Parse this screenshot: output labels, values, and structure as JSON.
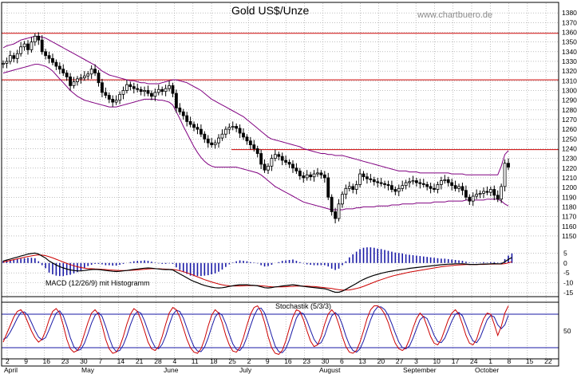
{
  "chart_data": {
    "type": "candlestick",
    "title": "Gold US$/Unze",
    "watermark": "www.chartbuero.de",
    "colors": {
      "candle": "#000000",
      "bollinger": "#800080",
      "resistance": "#cc0000",
      "grid": "#999999",
      "macd_line": "#000000",
      "signal_line": "#cc0000",
      "histogram": "#1a1aa6",
      "stoch_k": "#cc0000",
      "stoch_d": "#1a1aa6",
      "stoch_level": "#1a1aa6"
    },
    "price_panel": {
      "ylim": [
        1145,
        1390
      ],
      "y_ticks": [
        1150,
        1160,
        1170,
        1180,
        1190,
        1200,
        1210,
        1220,
        1230,
        1240,
        1250,
        1260,
        1270,
        1280,
        1290,
        1300,
        1310,
        1320,
        1330,
        1340,
        1350,
        1360,
        1370,
        1380
      ],
      "resistance_lines": [
        1359,
        1311,
        1239
      ],
      "close": [
        1328,
        1330,
        1336,
        1333,
        1338,
        1345,
        1348,
        1342,
        1350,
        1356,
        1352,
        1340,
        1336,
        1333,
        1329,
        1325,
        1322,
        1318,
        1314,
        1305,
        1309,
        1312,
        1313,
        1315,
        1317,
        1322,
        1318,
        1308,
        1298,
        1295,
        1291,
        1288,
        1290,
        1296,
        1300,
        1306,
        1304,
        1302,
        1301,
        1299,
        1300,
        1297,
        1294,
        1298,
        1301,
        1299,
        1302,
        1305,
        1297,
        1282,
        1278,
        1274,
        1268,
        1265,
        1262,
        1260,
        1255,
        1250,
        1246,
        1244,
        1246,
        1251,
        1255,
        1260,
        1262,
        1263,
        1261,
        1256,
        1252,
        1248,
        1244,
        1240,
        1235,
        1224,
        1218,
        1222,
        1230,
        1234,
        1232,
        1228,
        1226,
        1224,
        1220,
        1217,
        1212,
        1210,
        1213,
        1211,
        1214,
        1215,
        1213,
        1210,
        1190,
        1175,
        1168,
        1183,
        1193,
        1199,
        1201,
        1198,
        1203,
        1214,
        1211,
        1209,
        1208,
        1206,
        1205,
        1204,
        1203,
        1202,
        1198,
        1196,
        1199,
        1202,
        1205,
        1206,
        1207,
        1205,
        1204,
        1203,
        1201,
        1199,
        1198,
        1203,
        1207,
        1208,
        1205,
        1202,
        1199,
        1201,
        1197,
        1190,
        1186,
        1191,
        1193,
        1194,
        1196,
        1195,
        1198,
        1192,
        1188,
        1201,
        1225,
        1221
      ],
      "upper_band": [
        1344,
        1346,
        1347,
        1348,
        1350,
        1352,
        1353,
        1354,
        1355,
        1356,
        1356,
        1355,
        1354,
        1352,
        1350,
        1348,
        1346,
        1344,
        1342,
        1340,
        1338,
        1336,
        1334,
        1332,
        1330,
        1328,
        1326,
        1323,
        1320,
        1318,
        1316,
        1315,
        1314,
        1313,
        1312,
        1311,
        1310,
        1310,
        1309,
        1308,
        1308,
        1307,
        1307,
        1307,
        1307,
        1308,
        1309,
        1310,
        1311,
        1311,
        1310,
        1309,
        1308,
        1306,
        1304,
        1302,
        1300,
        1297,
        1294,
        1291,
        1289,
        1287,
        1285,
        1283,
        1281,
        1279,
        1277,
        1275,
        1273,
        1270,
        1267,
        1264,
        1261,
        1258,
        1255,
        1252,
        1250,
        1249,
        1248,
        1247,
        1246,
        1245,
        1244,
        1243,
        1242,
        1240,
        1239,
        1238,
        1237,
        1236,
        1235,
        1235,
        1234,
        1234,
        1233,
        1233,
        1233,
        1232,
        1231,
        1230,
        1229,
        1228,
        1227,
        1226,
        1225,
        1224,
        1223,
        1222,
        1221,
        1220,
        1219,
        1218,
        1217,
        1217,
        1217,
        1216,
        1216,
        1216,
        1215,
        1215,
        1215,
        1215,
        1215,
        1215,
        1215,
        1215,
        1215,
        1214,
        1214,
        1214,
        1214,
        1213,
        1213,
        1213,
        1213,
        1213,
        1213,
        1213,
        1213,
        1213,
        1213,
        1222,
        1234,
        1238
      ],
      "lower_band": [
        1318,
        1319,
        1320,
        1321,
        1322,
        1323,
        1324,
        1325,
        1326,
        1327,
        1327,
        1326,
        1325,
        1323,
        1320,
        1316,
        1312,
        1308,
        1304,
        1300,
        1297,
        1294,
        1292,
        1290,
        1289,
        1288,
        1287,
        1286,
        1285,
        1284,
        1283,
        1283,
        1283,
        1284,
        1285,
        1286,
        1287,
        1288,
        1289,
        1290,
        1291,
        1291,
        1291,
        1291,
        1290,
        1290,
        1289,
        1288,
        1285,
        1278,
        1271,
        1263,
        1256,
        1249,
        1242,
        1236,
        1231,
        1227,
        1224,
        1222,
        1221,
        1221,
        1221,
        1221,
        1221,
        1221,
        1221,
        1220,
        1219,
        1218,
        1217,
        1216,
        1215,
        1213,
        1210,
        1207,
        1204,
        1201,
        1199,
        1197,
        1195,
        1193,
        1191,
        1189,
        1187,
        1185,
        1184,
        1183,
        1182,
        1181,
        1180,
        1179,
        1178,
        1177,
        1177,
        1177,
        1177,
        1178,
        1178,
        1178,
        1179,
        1179,
        1180,
        1180,
        1180,
        1180,
        1181,
        1181,
        1181,
        1181,
        1182,
        1182,
        1182,
        1183,
        1183,
        1183,
        1183,
        1184,
        1184,
        1184,
        1184,
        1184,
        1185,
        1185,
        1185,
        1185,
        1186,
        1186,
        1186,
        1186,
        1186,
        1187,
        1187,
        1187,
        1187,
        1187,
        1187,
        1188,
        1188,
        1188,
        1188,
        1186,
        1183,
        1181
      ]
    },
    "macd_panel": {
      "label": "MACD (12/26/9) mit Histogramm",
      "ylim": [
        -17,
        10
      ],
      "y_ticks": [
        5,
        0,
        -5,
        -10,
        -15
      ],
      "macd": [
        1,
        1.5,
        2,
        2.5,
        3,
        3.5,
        4,
        4.5,
        4.8,
        5,
        4.5,
        3.5,
        2.5,
        1,
        0,
        -1,
        -1.8,
        -2.5,
        -3,
        -3.5,
        -3.8,
        -4,
        -4,
        -3.8,
        -3.5,
        -3.3,
        -3.2,
        -3.3,
        -3.5,
        -3.8,
        -4,
        -4.2,
        -4.3,
        -4.2,
        -4,
        -3.8,
        -3.5,
        -3.2,
        -3,
        -2.8,
        -2.6,
        -2.5,
        -2.6,
        -2.8,
        -3,
        -3.2,
        -3.3,
        -3.3,
        -3.5,
        -4.5,
        -5.5,
        -6.5,
        -7.5,
        -8.5,
        -9.3,
        -10,
        -10.7,
        -11.3,
        -11.8,
        -12.2,
        -12.5,
        -12.6,
        -12.5,
        -12.2,
        -11.8,
        -11.5,
        -11.2,
        -11,
        -11,
        -11,
        -11.2,
        -11.3,
        -11.5,
        -12,
        -12.5,
        -12.6,
        -12.4,
        -12.1,
        -11.9,
        -11.6,
        -11.4,
        -11.2,
        -11,
        -11.2,
        -11.5,
        -11.8,
        -12,
        -12.2,
        -12.4,
        -12.6,
        -12.8,
        -13,
        -13.5,
        -14.2,
        -14.8,
        -14.8,
        -14.2,
        -13.3,
        -12.3,
        -11.3,
        -10.3,
        -9.2,
        -8.3,
        -7.5,
        -6.8,
        -6.2,
        -5.7,
        -5.2,
        -4.8,
        -4.4,
        -4.1,
        -3.8,
        -3.5,
        -3.2,
        -3,
        -2.7,
        -2.5,
        -2.3,
        -2.1,
        -1.9,
        -1.7,
        -1.5,
        -1.3,
        -1.1,
        -0.9,
        -0.7,
        -0.6,
        -0.5,
        -0.4,
        -0.4,
        -0.4,
        -0.5,
        -0.7,
        -0.7,
        -0.7,
        -0.6,
        -0.5,
        -0.5,
        -0.4,
        -0.3,
        -0.4,
        -0.4,
        0.6,
        1.8,
        2.8
      ],
      "signal": [
        0.5,
        0.9,
        1.3,
        1.7,
        2.1,
        2.5,
        2.9,
        3.3,
        3.6,
        3.9,
        4.1,
        4,
        3.7,
        3.2,
        2.6,
        1.9,
        1.2,
        0.5,
        -0.2,
        -0.8,
        -1.4,
        -1.9,
        -2.3,
        -2.6,
        -2.8,
        -2.9,
        -3,
        -3.1,
        -3.2,
        -3.3,
        -3.5,
        -3.6,
        -3.7,
        -3.8,
        -3.8,
        -3.8,
        -3.7,
        -3.6,
        -3.5,
        -3.3,
        -3.2,
        -3,
        -2.9,
        -2.9,
        -2.9,
        -3,
        -3.1,
        -3.2,
        -3.3,
        -3.5,
        -3.9,
        -4.4,
        -5,
        -5.6,
        -6.3,
        -7,
        -7.7,
        -8.4,
        -9,
        -9.6,
        -10.1,
        -10.6,
        -11,
        -11.3,
        -11.5,
        -11.6,
        -11.6,
        -11.6,
        -11.5,
        -11.4,
        -11.4,
        -11.4,
        -11.4,
        -11.5,
        -11.7,
        -11.9,
        -12,
        -12.1,
        -12.1,
        -12.1,
        -12,
        -11.9,
        -11.8,
        -11.7,
        -11.7,
        -11.7,
        -11.7,
        -11.8,
        -11.9,
        -12.1,
        -12.3,
        -12.5,
        -12.7,
        -12.9,
        -13.2,
        -13.5,
        -13.7,
        -13.7,
        -13.6,
        -13.3,
        -12.9,
        -12.4,
        -11.8,
        -11.1,
        -10.4,
        -9.7,
        -9,
        -8.4,
        -7.8,
        -7.2,
        -6.7,
        -6.2,
        -5.8,
        -5.4,
        -5,
        -4.6,
        -4.3,
        -4,
        -3.7,
        -3.4,
        -3.1,
        -2.8,
        -2.5,
        -2.2,
        -1.9,
        -1.7,
        -1.5,
        -1.3,
        -1.1,
        -1,
        -0.9,
        -0.8,
        -0.8,
        -0.8,
        -0.8,
        -0.7,
        -0.7,
        -0.6,
        -0.6,
        -0.5,
        -0.5,
        -0.5,
        -0.3,
        0.1,
        0.6
      ]
    },
    "stoch_panel": {
      "label": "Stochastik (5/3/3)",
      "ylim": [
        0,
        100
      ],
      "y_ticks": [
        50
      ],
      "levels": [
        80,
        20
      ],
      "k": [
        30,
        45,
        60,
        75,
        85,
        88,
        80,
        65,
        50,
        38,
        30,
        35,
        50,
        70,
        85,
        90,
        82,
        60,
        35,
        18,
        12,
        15,
        25,
        45,
        65,
        82,
        88,
        80,
        60,
        35,
        18,
        10,
        12,
        22,
        40,
        62,
        80,
        90,
        85,
        70,
        50,
        30,
        18,
        15,
        22,
        40,
        62,
        82,
        92,
        88,
        75,
        55,
        35,
        20,
        12,
        10,
        18,
        35,
        58,
        78,
        88,
        82,
        65,
        42,
        25,
        14,
        12,
        20,
        38,
        60,
        80,
        92,
        95,
        85,
        65,
        40,
        20,
        10,
        8,
        15,
        32,
        55,
        75,
        88,
        85,
        70,
        50,
        32,
        22,
        25,
        40,
        62,
        80,
        88,
        80,
        62,
        40,
        22,
        12,
        10,
        15,
        30,
        50,
        72,
        88,
        95,
        95,
        90,
        80,
        65,
        45,
        28,
        18,
        15,
        20,
        35,
        55,
        72,
        82,
        75,
        58,
        40,
        28,
        25,
        35,
        52,
        70,
        82,
        88,
        80,
        62,
        42,
        28,
        25,
        35,
        55,
        72,
        82,
        80,
        62,
        42,
        58,
        82,
        95
      ],
      "d": [
        35,
        38,
        48,
        60,
        73,
        83,
        84,
        78,
        65,
        51,
        39,
        34,
        38,
        52,
        68,
        82,
        86,
        77,
        59,
        38,
        22,
        15,
        17,
        28,
        45,
        64,
        78,
        83,
        76,
        58,
        38,
        21,
        13,
        15,
        25,
        41,
        61,
        77,
        85,
        82,
        68,
        50,
        33,
        21,
        18,
        26,
        41,
        61,
        79,
        87,
        85,
        73,
        55,
        37,
        22,
        14,
        13,
        21,
        37,
        57,
        75,
        83,
        78,
        63,
        44,
        27,
        17,
        15,
        23,
        39,
        59,
        77,
        89,
        91,
        82,
        63,
        42,
        23,
        13,
        11,
        18,
        34,
        54,
        73,
        83,
        81,
        68,
        51,
        35,
        26,
        29,
        42,
        61,
        77,
        83,
        77,
        61,
        41,
        25,
        15,
        12,
        18,
        32,
        51,
        70,
        85,
        93,
        93,
        88,
        78,
        63,
        46,
        30,
        20,
        18,
        23,
        37,
        54,
        70,
        76,
        72,
        58,
        42,
        31,
        29,
        37,
        52,
        68,
        80,
        83,
        77,
        61,
        44,
        32,
        29,
        38,
        54,
        70,
        78,
        75,
        61,
        54,
        61,
        78
      ]
    },
    "x_axis": {
      "day_labels": [
        "2",
        "9",
        "16",
        "23",
        "30",
        "7",
        "14",
        "21",
        "28",
        "4",
        "11",
        "18",
        "25",
        "2",
        "9",
        "16",
        "23",
        "30",
        "6",
        "13",
        "20",
        "27",
        "3",
        "10",
        "17",
        "24",
        "1",
        "8",
        "15",
        "22"
      ],
      "month_labels": [
        "April",
        "May",
        "June",
        "July",
        "August",
        "September",
        "October"
      ]
    }
  }
}
